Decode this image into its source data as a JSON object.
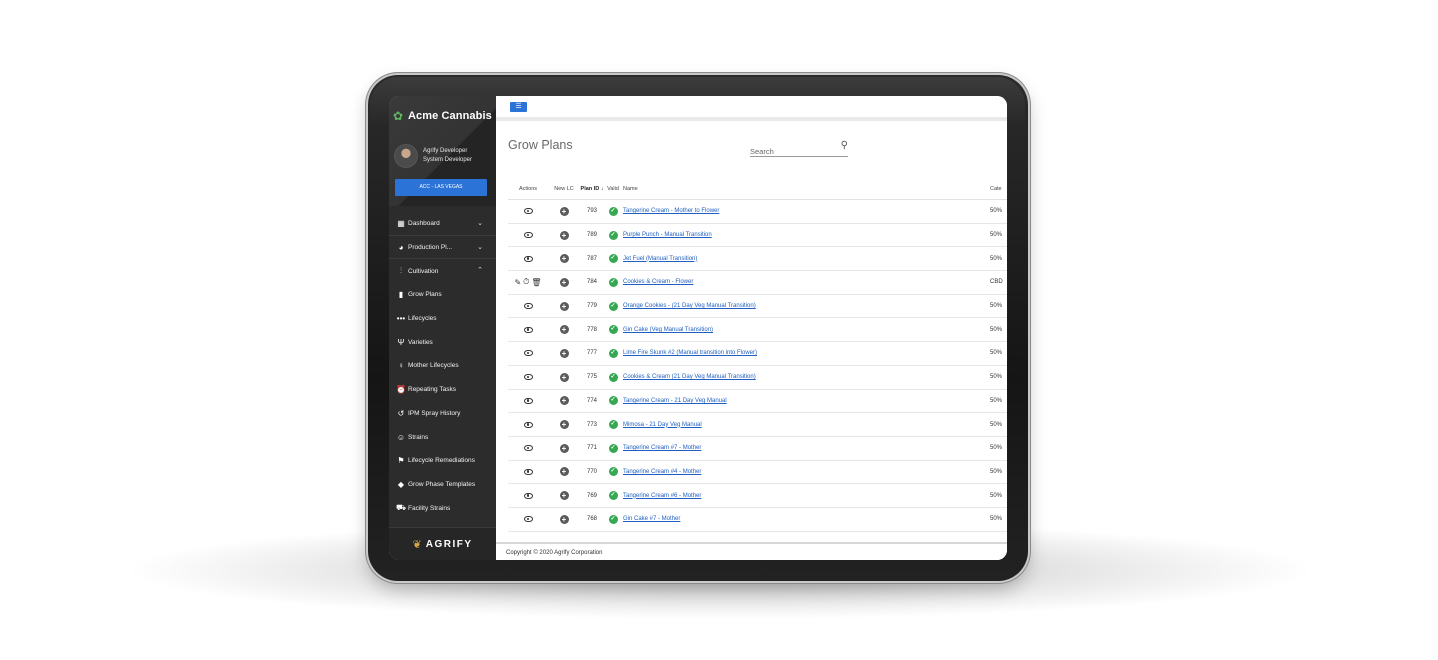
{
  "brand": {
    "name": "Acme Cannabis"
  },
  "user": {
    "name": "Agrify Developer",
    "role": "System Developer"
  },
  "location_button": "ACC - LAS VEGAS",
  "sidebar": {
    "items": [
      {
        "label": "Dashboard",
        "icon": "dashboard-icon"
      },
      {
        "label": "Production Pl...",
        "icon": "pie-chart-icon"
      },
      {
        "label": "Cultivation",
        "icon": "waveform-icon"
      },
      {
        "label": "Grow Plans",
        "icon": "bar-chart-icon"
      },
      {
        "label": "Lifecycles",
        "icon": "dots-icon"
      },
      {
        "label": "Varieties",
        "icon": "fork-knife-icon"
      },
      {
        "label": "Mother Lifecycles",
        "icon": "mother-icon"
      },
      {
        "label": "Repeating Tasks",
        "icon": "alarm-icon"
      },
      {
        "label": "IPM Spray History",
        "icon": "history-icon"
      },
      {
        "label": "Strains",
        "icon": "smiley-icon"
      },
      {
        "label": "Lifecycle Remediations",
        "icon": "remediation-icon"
      },
      {
        "label": "Grow Phase Templates",
        "icon": "diamond-icon"
      },
      {
        "label": "Facility Strains",
        "icon": "cart-icon"
      }
    ],
    "footer_logo": "AGRIFY"
  },
  "main": {
    "title": "Grow Plans",
    "search_placeholder": "Search",
    "columns": {
      "actions": "Actions",
      "new_lc": "New LC",
      "plan_id": "Plan ID",
      "valid": "Valid",
      "name": "Name",
      "category": "Cate"
    },
    "rows": [
      {
        "id": "793",
        "name": "Tangerine Cream - Mother to Flower",
        "cat": "50%",
        "editable": false
      },
      {
        "id": "789",
        "name": "Purple Punch - Manual Transition",
        "cat": "50%",
        "editable": false
      },
      {
        "id": "787",
        "name": "Jet Fuel (Manual Transition)",
        "cat": "50%",
        "editable": false
      },
      {
        "id": "784",
        "name": "Cookies & Cream - Flower",
        "cat": "CBD",
        "editable": true
      },
      {
        "id": "779",
        "name": "Orange Cookies - (21 Day Veg Manual Transition)",
        "cat": "50%",
        "editable": false
      },
      {
        "id": "778",
        "name": "Gin Cake (Veg Manual Transition)",
        "cat": "50%",
        "editable": false
      },
      {
        "id": "777",
        "name": "Lime Fire Skunk #2 (Manual transition into Flower)",
        "cat": "50%",
        "editable": false
      },
      {
        "id": "775",
        "name": "Cookies & Cream (21 Day Veg Manual Transition)",
        "cat": "50%",
        "editable": false
      },
      {
        "id": "774",
        "name": "Tangerine Cream - 21 Day Veg Manual",
        "cat": "50%",
        "editable": false
      },
      {
        "id": "773",
        "name": "Mimosa - 21 Day Veg Manual",
        "cat": "50%",
        "editable": false
      },
      {
        "id": "771",
        "name": "Tangerine Cream #7 - Mother",
        "cat": "50%",
        "editable": false
      },
      {
        "id": "770",
        "name": "Tangerine Cream #4 - Mother",
        "cat": "50%",
        "editable": false
      },
      {
        "id": "769",
        "name": "Tangerine Cream #6 - Mother",
        "cat": "50%",
        "editable": false
      },
      {
        "id": "768",
        "name": "Gin Cake #7 - Mother",
        "cat": "50%",
        "editable": false
      }
    ]
  },
  "footer": "Copyright © 2020 Agrify Corporation",
  "colors": {
    "accent": "#2b73d6",
    "sidebar": "#2c2c2c",
    "valid": "#36a852",
    "link": "#1f5fbf"
  }
}
